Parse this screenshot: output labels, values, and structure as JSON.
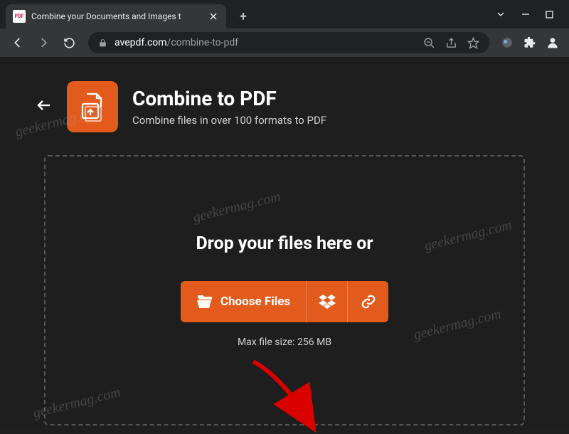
{
  "browser": {
    "tab_title": "Combine your Documents and Images t",
    "url_domain": "avepdf.com",
    "url_path": "/combine-to-pdf"
  },
  "page": {
    "title": "Combine to PDF",
    "subtitle": "Combine files in over 100 formats to PDF",
    "drop_label": "Drop your files here or",
    "choose_files_label": "Choose Files",
    "max_size": "Max file size: 256 MB"
  },
  "watermark": "geekermag.com",
  "colors": {
    "accent": "#e35b1c"
  }
}
